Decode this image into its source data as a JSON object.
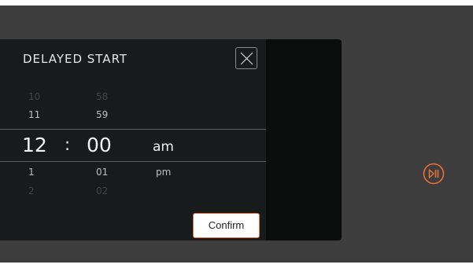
{
  "dialog": {
    "title": "DELAYED START",
    "close_icon": "close-icon",
    "confirm_label": "Confirm"
  },
  "picker": {
    "rows_above": [
      {
        "hour": "10",
        "minute": "58",
        "ampm": ""
      },
      {
        "hour": "11",
        "minute": "59",
        "ampm": ""
      }
    ],
    "selected": {
      "hour": "12",
      "separator": ":",
      "minute": "00",
      "ampm": "am"
    },
    "rows_below": [
      {
        "hour": "1",
        "minute": "01",
        "ampm": "pm"
      },
      {
        "hour": "2",
        "minute": "02",
        "ampm": ""
      }
    ]
  },
  "controls": {
    "play_pause_icon": "play-pause-icon",
    "accent_color": "#e8703a"
  }
}
